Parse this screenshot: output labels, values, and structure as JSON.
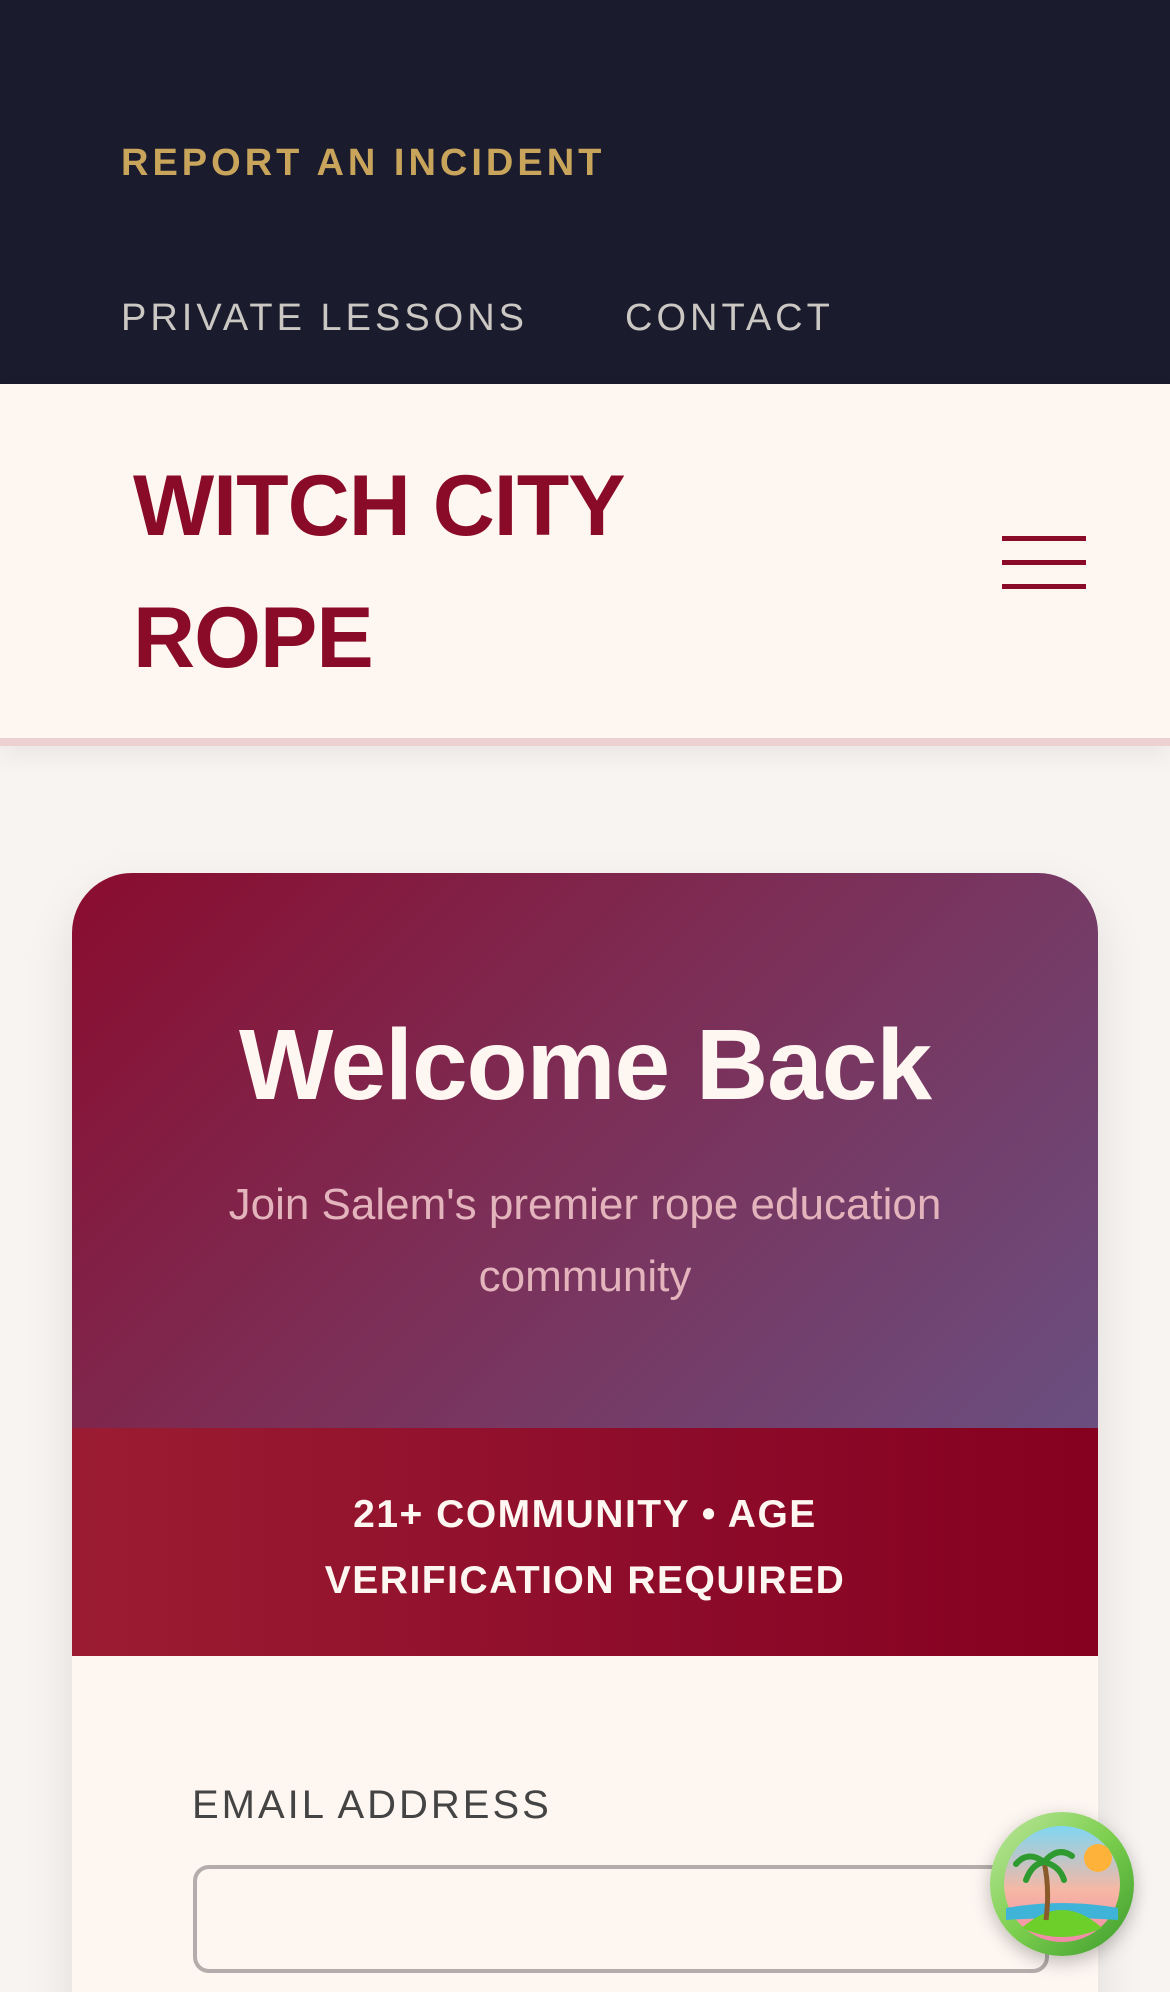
{
  "topbar": {
    "report_label": "REPORT AN INCIDENT",
    "links": [
      "PRIVATE LESSONS",
      "CONTACT"
    ]
  },
  "header": {
    "brand": "WITCH CITY ROPE",
    "menu_icon": "hamburger-menu-icon"
  },
  "card": {
    "title": "Welcome Back",
    "subtitle": "Join Salem's premier rope education community",
    "age_notice": "21+ COMMUNITY • AGE VERIFICATION REQUIRED",
    "email_label": "EMAIL ADDRESS",
    "email_value": ""
  },
  "widget": {
    "icon": "tropical-island-icon"
  },
  "colors": {
    "topbar_bg": "#1b1b2e",
    "accent_gold": "#c9a55c",
    "brand_burgundy": "#8a0b27",
    "page_bg": "#f8f4f2"
  }
}
